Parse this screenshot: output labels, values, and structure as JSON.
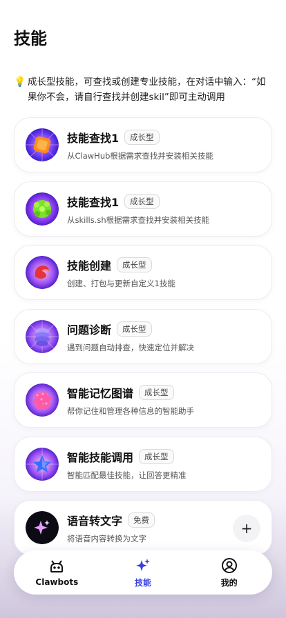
{
  "header": {
    "title": "技能"
  },
  "tip": {
    "icon": "lightbulb-icon",
    "text": "成长型技能，可查找或创建专业技能，在对话中输入：“如果你不会，请自行查找并创建skil”即可主动调用"
  },
  "skills": [
    {
      "title": "技能查找1",
      "badge": "成长型",
      "desc": "从ClawHub根据需求查找并安装相关技能",
      "icon": "orange-cube-icon"
    },
    {
      "title": "技能查找1",
      "badge": "成长型",
      "desc": "从skills.sh根据需求查找并安装相关技能",
      "icon": "green-blob-icon"
    },
    {
      "title": "技能创建",
      "badge": "成长型",
      "desc": "创建、打包与更新自定义1技能",
      "icon": "red-claw-icon"
    },
    {
      "title": "问题诊断",
      "badge": "成长型",
      "desc": "遇到问题自动排查，快速定位并解决",
      "icon": "spiral-icon"
    },
    {
      "title": "智能记忆图谱",
      "badge": "成长型",
      "desc": "帮你记住和管理各种信息的智能助手",
      "icon": "pink-berry-icon"
    },
    {
      "title": "智能技能调用",
      "badge": "成长型",
      "desc": "智能匹配最佳技能，让回答更精准",
      "icon": "blue-star-icon"
    },
    {
      "title": "语音转文字",
      "badge": "免费",
      "desc": "将语音内容转换为文字",
      "icon": "sparkle-icon",
      "action": "+"
    }
  ],
  "nav": [
    {
      "label": "Clawbots",
      "icon": "robot-icon",
      "active": false
    },
    {
      "label": "技能",
      "icon": "sparkle-icon",
      "active": true
    },
    {
      "label": "我的",
      "icon": "profile-icon",
      "active": false
    }
  ],
  "colors": {
    "accent": "#3b3fe0"
  }
}
